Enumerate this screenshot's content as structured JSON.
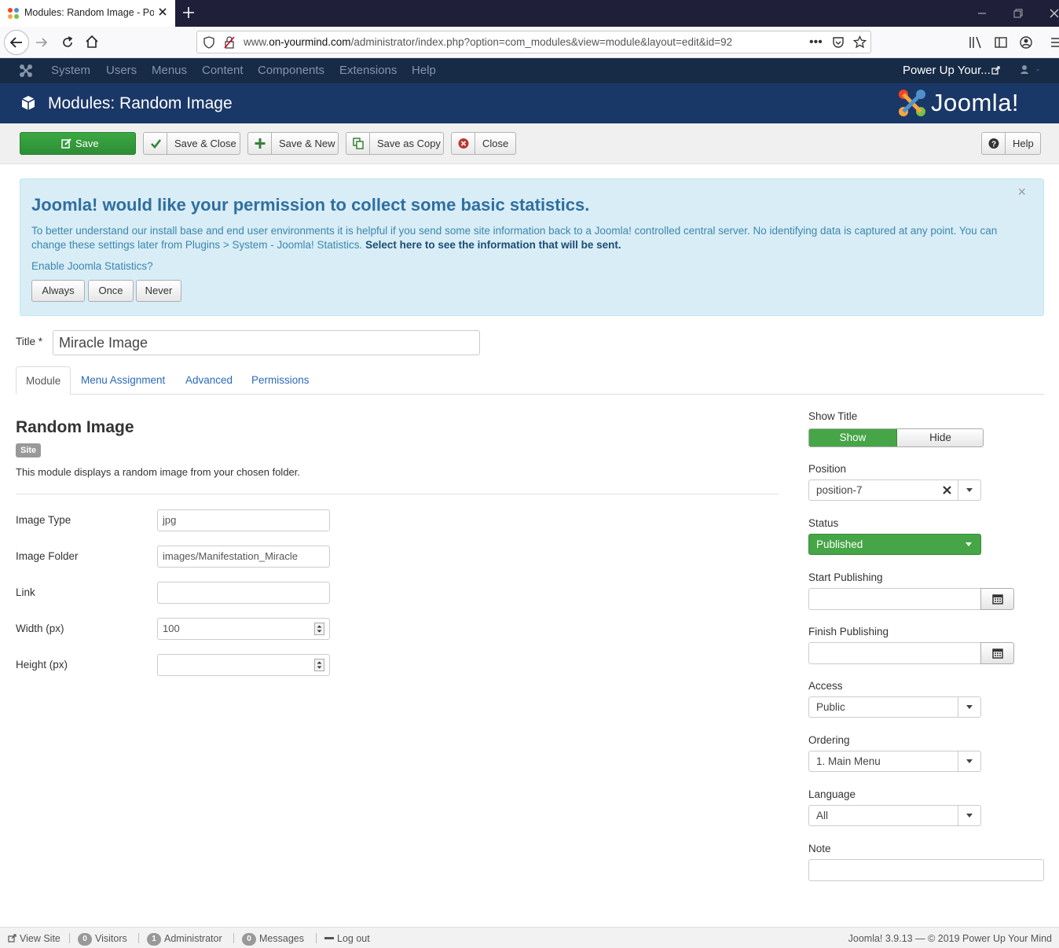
{
  "browser": {
    "tab_title": "Modules: Random Image - Power Up Your Mind",
    "url_prefix": "www.",
    "url_domain": "on-yourmind.com",
    "url_path": "/administrator/index.php?option=com_modules&view=module&layout=edit&id=92"
  },
  "admin_menu": {
    "items": [
      "System",
      "Users",
      "Menus",
      "Content",
      "Components",
      "Extensions",
      "Help"
    ],
    "site_link": "Power Up Your..."
  },
  "header": {
    "title": "Modules: Random Image",
    "logo_text": "Joomla!"
  },
  "toolbar": {
    "save": "Save",
    "save_close": "Save & Close",
    "save_new": "Save & New",
    "save_copy": "Save as Copy",
    "close": "Close",
    "help": "Help"
  },
  "stats_alert": {
    "heading": "Joomla! would like your permission to collect some basic statistics.",
    "body": "To better understand our install base and end user environments it is helpful if you send some site information back to a Joomla! controlled central server. No identifying data is captured at any point. You can change these settings later from Plugins > System - Joomla! Statistics.",
    "body_link": "Select here to see the information that will be sent.",
    "question": "Enable Joomla Statistics?",
    "always": "Always",
    "once": "Once",
    "never": "Never",
    "close_glyph": "×"
  },
  "title_field": {
    "label": "Title *",
    "value": "Miracle Image"
  },
  "tabs": [
    "Module",
    "Menu Assignment",
    "Advanced",
    "Permissions"
  ],
  "module_info": {
    "name": "Random Image",
    "badge": "Site",
    "description": "This module displays a random image from your chosen folder."
  },
  "fields": {
    "image_type": {
      "label": "Image Type",
      "value": "jpg"
    },
    "image_folder": {
      "label": "Image Folder",
      "value": "images/Manifestation_Miracle"
    },
    "link": {
      "label": "Link",
      "value": ""
    },
    "width": {
      "label": "Width (px)",
      "value": "100"
    },
    "height": {
      "label": "Height (px)",
      "value": ""
    }
  },
  "sidebar": {
    "show_title": {
      "label": "Show Title",
      "show": "Show",
      "hide": "Hide"
    },
    "position": {
      "label": "Position",
      "value": "position-7"
    },
    "status": {
      "label": "Status",
      "value": "Published"
    },
    "start_publishing": {
      "label": "Start Publishing"
    },
    "finish_publishing": {
      "label": "Finish Publishing"
    },
    "access": {
      "label": "Access",
      "value": "Public"
    },
    "ordering": {
      "label": "Ordering",
      "value": "1. Main Menu"
    },
    "language": {
      "label": "Language",
      "value": "All"
    },
    "note": {
      "label": "Note",
      "value": ""
    }
  },
  "footer": {
    "view_site": "View Site",
    "visitors_count": "0",
    "visitors": "Visitors",
    "admin_count": "1",
    "admin": "Administrator",
    "messages_count": "0",
    "messages": "Messages",
    "logout": "Log out",
    "version": "Joomla! 3.9.13 — © 2019 Power Up Your Mind"
  },
  "colors": {
    "joomla_header": "#1a3867",
    "admin_menu": "#172a46",
    "success_green": "#46a546",
    "alert_bg": "#d9edf7"
  }
}
